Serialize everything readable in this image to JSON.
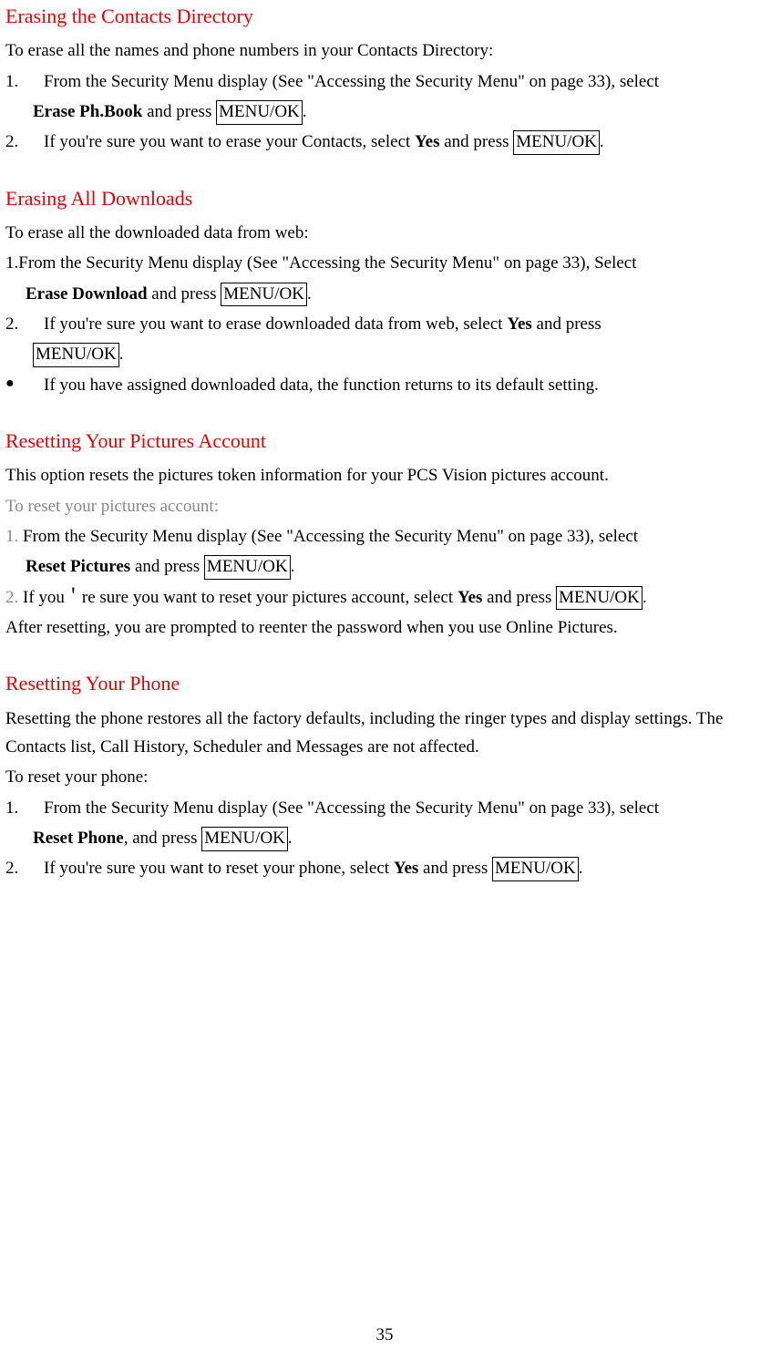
{
  "s1": {
    "heading": "Erasing the Contacts Directory",
    "intro": "To erase all the names and phone numbers in your Contacts Directory:",
    "step1_num": "1.",
    "step1_a": "From the Security Menu display (See \"Accessing the Security Menu\" on page 33), select",
    "step1_bold": "Erase Ph.Book",
    "step1_b": " and press ",
    "step1_box": "MENU/OK",
    "step1_c": ".",
    "step2_num": "2.",
    "step2_a": "If you're sure you want to erase your Contacts, select ",
    "step2_bold": "Yes",
    "step2_b": " and press ",
    "step2_box": "MENU/OK",
    "step2_c": "."
  },
  "s2": {
    "heading": "Erasing All Downloads",
    "intro": "To erase all the downloaded data from web:",
    "step1_num": "1.",
    "step1_a": "From the Security Menu display (See \"Accessing the Security Menu\" on page 33), Select",
    "step1_bold": "Erase Download",
    "step1_b": " and press ",
    "step1_box": "MENU/OK",
    "step1_c": ".",
    "step2_num": "2.",
    "step2_a": "If you're sure you want to erase downloaded data from web, select ",
    "step2_bold": "Yes",
    "step2_b": " and press ",
    "step2_box": "MENU/OK",
    "step2_c": ".",
    "bullet_dot": "●",
    "bullet_text": "If you have assigned downloaded data, the function returns to its default setting."
  },
  "s3": {
    "heading": "Resetting Your Pictures Account",
    "intro1": "This option resets the pictures token information for your PCS Vision pictures account.",
    "intro2": "To reset your pictures account:",
    "step1_num": "1.",
    "step1_a": " From the Security Menu display (See \"Accessing the Security Menu\" on page 33), select",
    "step1_bold": "Reset Pictures",
    "step1_b": " and press ",
    "step1_box": "MENU/OK",
    "step1_c": ".",
    "step2_num": "2.",
    "step2_a": " If you＇re sure you want to reset your pictures account, select ",
    "step2_bold": "Yes",
    "step2_b": " and press ",
    "step2_box": "MENU/OK",
    "step2_c": ".",
    "after": "After resetting, you are prompted to reenter the password when you use Online Pictures."
  },
  "s4": {
    "heading": "Resetting Your Phone",
    "intro1": "Resetting the phone restores all the factory defaults, including the ringer types and display settings. The Contacts list, Call History, Scheduler and Messages are not affected.",
    "intro2": "To reset your phone:",
    "step1_num": "1.",
    "step1_a": "From the Security Menu display (See \"Accessing the Security Menu\" on page 33), select",
    "step1_bold": "Reset Phone",
    "step1_b": ", and press ",
    "step1_box": "MENU/OK",
    "step1_c": ".",
    "step2_num": "2.",
    "step2_a": "If you're sure you want to reset your phone, select ",
    "step2_bold": "Yes",
    "step2_b": " and press ",
    "step2_box": "MENU/OK",
    "step2_c": "."
  },
  "page_number": "35"
}
